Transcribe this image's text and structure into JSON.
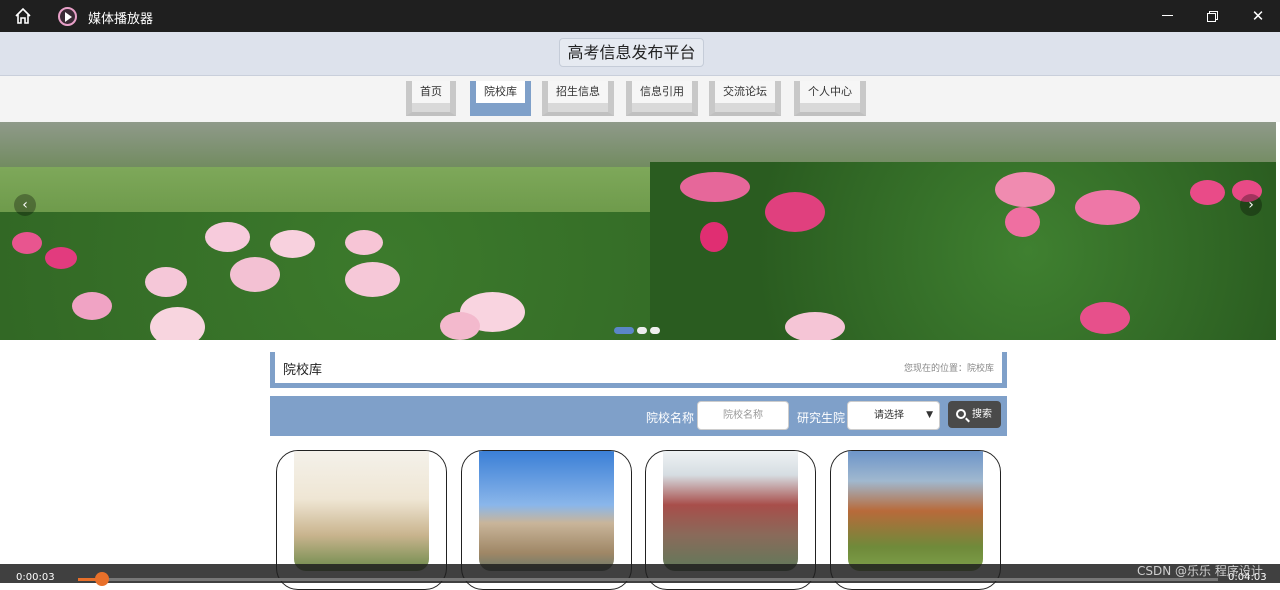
{
  "window": {
    "title": "媒体播放器"
  },
  "site": {
    "title": "高考信息发布平台"
  },
  "nav": {
    "items": [
      "首页",
      "院校库",
      "招生信息",
      "信息引用",
      "交流论坛",
      "个人中心"
    ],
    "active": "院校库"
  },
  "banner": {
    "prev": "‹",
    "next": "›"
  },
  "breadcrumb": {
    "title": "院校库",
    "location": "您现在的位置：院校库"
  },
  "search": {
    "name_label": "院校名称",
    "name_placeholder": "院校名称",
    "grad_label": "研究生院",
    "grad_select": "请选择",
    "button": "搜索"
  },
  "player": {
    "current": "0:00:03",
    "total": "0:04:03",
    "progress_fraction": 0.006
  },
  "watermark": "CSDN @乐乐 程序设计",
  "colors": {
    "accent": "#7fa0c9",
    "player_accent": "#e8702a"
  }
}
